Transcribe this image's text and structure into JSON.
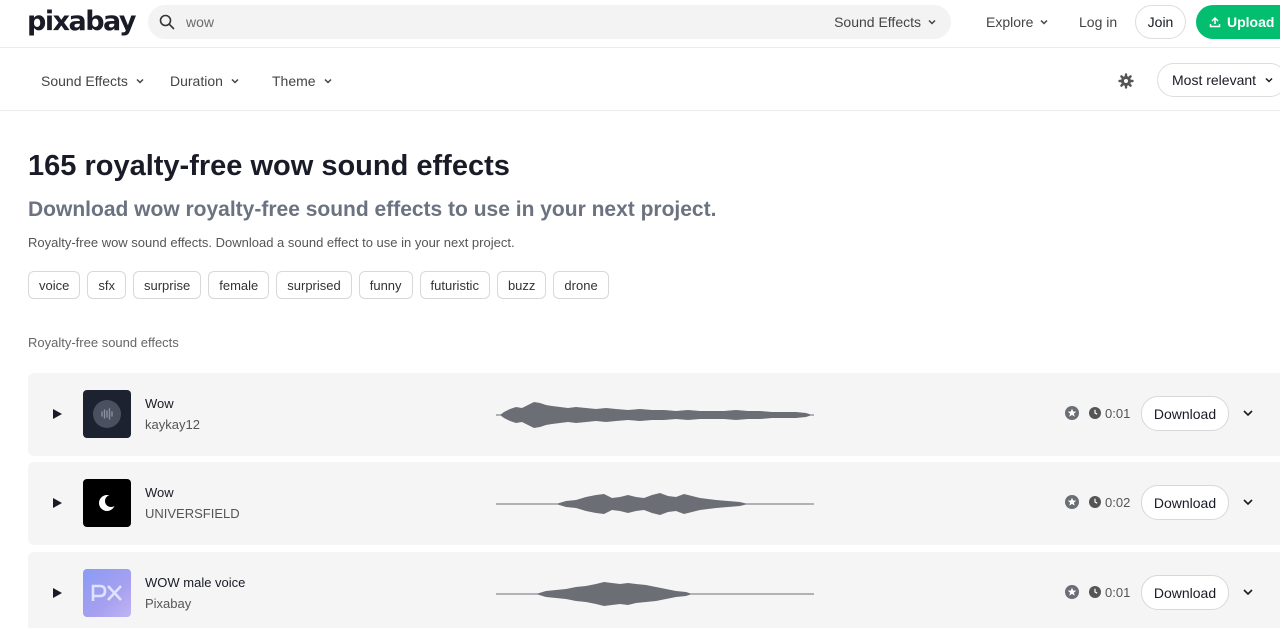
{
  "header": {
    "logo": "pixabay",
    "search_value": "wow",
    "search_type": "Sound Effects",
    "explore": "Explore",
    "login": "Log in",
    "join": "Join",
    "upload": "Upload",
    "accent": "#02be6e"
  },
  "filters": {
    "items": [
      "Sound Effects",
      "Duration",
      "Theme"
    ],
    "sort": "Most relevant"
  },
  "page": {
    "title": "165 royalty-free wow sound effects",
    "subtitle": "Download wow royalty-free sound effects to use in your next project.",
    "description": "Royalty-free wow sound effects. Download a sound effect to use in your next project.",
    "tags": [
      "voice",
      "sfx",
      "surprise",
      "female",
      "surprised",
      "funny",
      "futuristic",
      "buzz",
      "drone"
    ],
    "section_label": "Royalty-free sound effects"
  },
  "results": [
    {
      "title": "Wow",
      "author": "kaykay12",
      "duration": "0:01",
      "download": "Download"
    },
    {
      "title": "Wow",
      "author": "UNIVERSFIELD",
      "duration": "0:02",
      "download": "Download"
    },
    {
      "title": "WOW male voice",
      "author": "Pixabay",
      "duration": "0:01",
      "download": "Download"
    }
  ]
}
